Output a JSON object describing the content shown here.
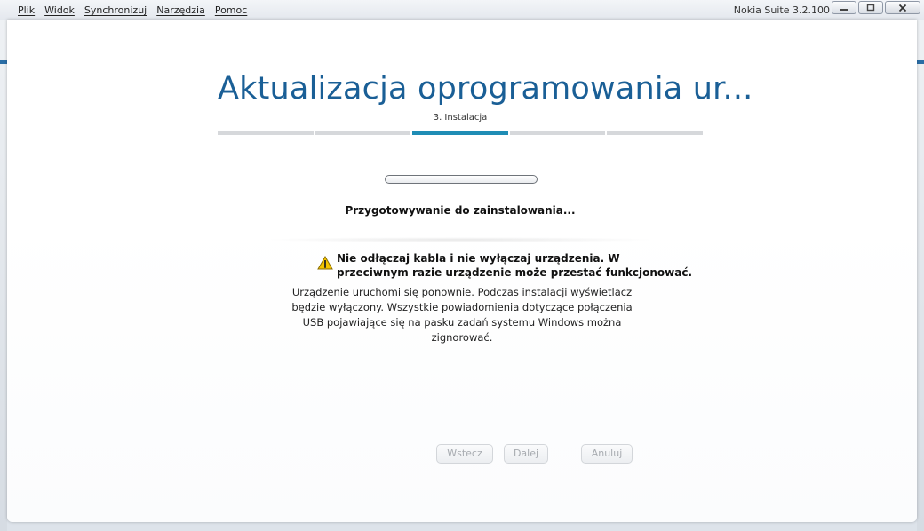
{
  "menu": {
    "items": [
      "Plik",
      "Widok",
      "Synchronizuj",
      "Narzędzia",
      "Pomoc"
    ]
  },
  "window": {
    "title": "Nokia Suite 3.2.100",
    "minimize_icon": "minimize-icon",
    "maximize_icon": "maximize-icon",
    "close_icon": "close-icon"
  },
  "wizard": {
    "title": "Aktualizacja oprogramowania ur...",
    "step_label": "3. Instalacja",
    "steps_total": 5,
    "active_step": 3,
    "progress": 0,
    "status": "Przygotowywanie do zainstalowania...",
    "warning": "Nie odłączaj kabla i nie wyłączaj urządzenia. W przeciwnym razie urządzenie może przestać funkcjonować.",
    "info": "Urządzenie uruchomi się ponownie. Podczas instalacji wyświetlacz będzie wyłączony. Wszystkie powiadomienia dotyczące połączenia USB pojawiające się na pasku zadań systemu Windows można zignorować."
  },
  "buttons": {
    "back": "Wstecz",
    "next": "Dalej",
    "cancel": "Anuluj"
  },
  "colors": {
    "accent": "#1a5f96",
    "active_step": "#1f8db5"
  }
}
